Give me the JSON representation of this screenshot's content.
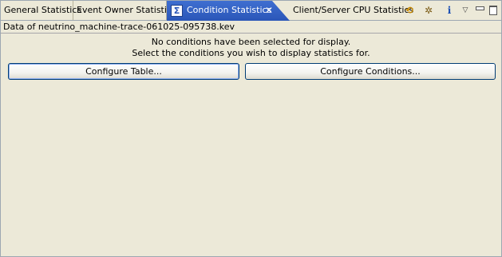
{
  "tabs": [
    {
      "label": "General Statistics"
    },
    {
      "label": "Event Owner Statistics"
    },
    {
      "label": "Condition Statistics",
      "active": true,
      "icon": "sigma-icon"
    },
    {
      "label": "Client/Server CPU Statistics"
    }
  ],
  "active_tab_close": "✕",
  "toolbar": {
    "icons": [
      "sync-icon",
      "bug-icon",
      "info-icon",
      "view-menu-icon",
      "minimize-icon",
      "maximize-icon"
    ]
  },
  "main": {
    "data_title": "Data of neutrino_machine-trace-061025-095738.kev",
    "message_line1": "No conditions have been selected for display.",
    "message_line2": "Select the conditions you wish to display statistics for.",
    "configure_table_label": "Configure Table...",
    "configure_conditions_label": "Configure Conditions..."
  },
  "colors": {
    "background": "#ece9d8",
    "active_tab": "#2a56b8",
    "button_border": "#003c74"
  }
}
